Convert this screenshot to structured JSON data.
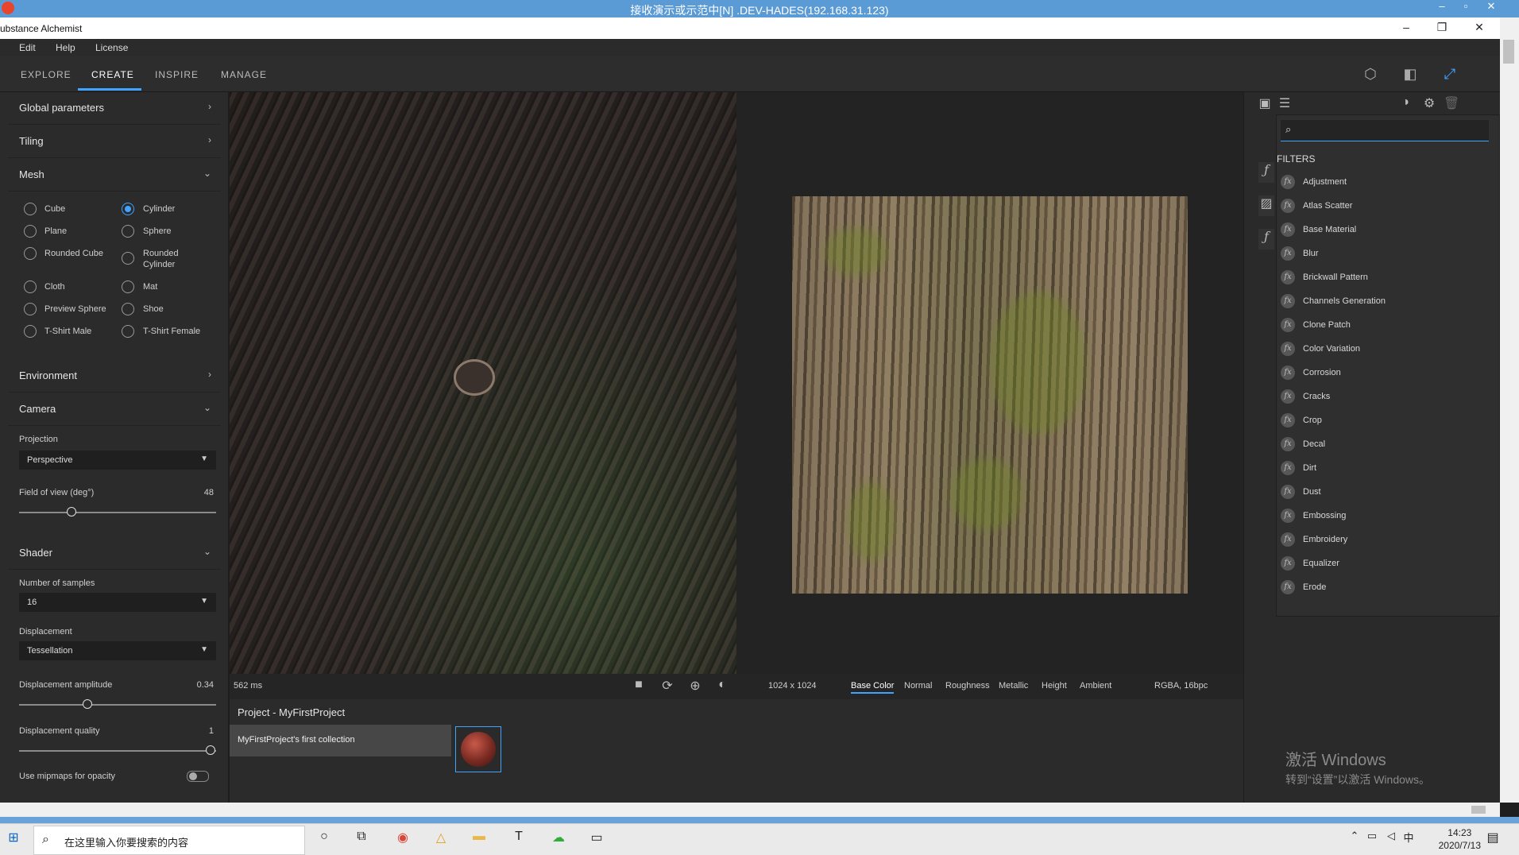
{
  "remote_title": "接收演示或示范中[N] .DEV-HADES(192.168.31.123)",
  "app_title": "ubstance Alchemist",
  "menu": [
    "Edit",
    "Help",
    "License"
  ],
  "tabs": [
    "EXPLORE",
    "CREATE",
    "INSPIRE",
    "MANAGE"
  ],
  "active_tab": "CREATE",
  "left": {
    "global_parameters": "Global parameters",
    "tiling": "Tiling",
    "mesh": "Mesh",
    "mesh_options": [
      {
        "label": "Cube",
        "selected": false
      },
      {
        "label": "Cylinder",
        "selected": true
      },
      {
        "label": "Plane",
        "selected": false
      },
      {
        "label": "Sphere",
        "selected": false
      },
      {
        "label": "Rounded Cube",
        "selected": false
      },
      {
        "label": "Rounded Cylinder",
        "selected": false
      },
      {
        "label": "Cloth",
        "selected": false
      },
      {
        "label": "Mat",
        "selected": false
      },
      {
        "label": "Preview Sphere",
        "selected": false
      },
      {
        "label": "Shoe",
        "selected": false
      },
      {
        "label": "T-Shirt Male",
        "selected": false
      },
      {
        "label": "T-Shirt Female",
        "selected": false
      }
    ],
    "environment": "Environment",
    "camera": "Camera",
    "projection_label": "Projection",
    "projection_value": "Perspective",
    "fov_label": "Field of view (deg°)",
    "fov_value": "48",
    "shader": "Shader",
    "samples_label": "Number of samples",
    "samples_value": "16",
    "displacement_label": "Displacement",
    "displacement_value": "Tessellation",
    "disp_amp_label": "Displacement amplitude",
    "disp_amp_value": "0.34",
    "disp_quality_label": "Displacement quality",
    "disp_quality_value": "1",
    "mipmaps_label": "Use mipmaps for opacity"
  },
  "viewport": {
    "render_time": "562 ms",
    "resolution": "1024 x 1024",
    "channels": [
      "Base Color",
      "Normal",
      "Roughness",
      "Metallic",
      "Height",
      "Ambient"
    ],
    "active_channel": "Base Color",
    "format": "RGBA, 16bpc"
  },
  "project": {
    "title": "Project - MyFirstProject",
    "collection": "MyFirstProject's first collection"
  },
  "right": {
    "search_value": "",
    "filters_header": "FILTERS",
    "filters": [
      "Adjustment",
      "Atlas Scatter",
      "Base Material",
      "Blur",
      "Brickwall Pattern",
      "Channels Generation",
      "Clone Patch",
      "Color Variation",
      "Corrosion",
      "Cracks",
      "Crop",
      "Decal",
      "Dirt",
      "Dust",
      "Embossing",
      "Embroidery",
      "Equalizer",
      "Erode"
    ],
    "watermark_line1": "激活 Windows",
    "watermark_line2": "转到“设置”以激活 Windows。"
  },
  "taskbar": {
    "search_placeholder": "在这里输入你要搜索的内容",
    "time": "14:23",
    "date": "2020/7/13",
    "ime": "中"
  },
  "colors": {
    "accent": "#3fa3ff",
    "panel": "#2b2b2b",
    "viewport": "#232323"
  }
}
